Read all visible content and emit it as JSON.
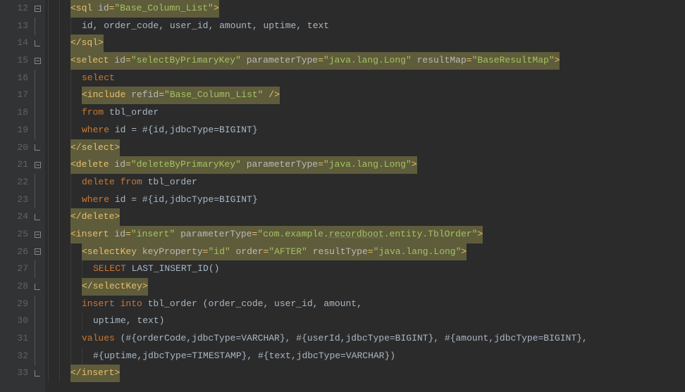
{
  "lines": [
    {
      "num": 12,
      "fold": "close",
      "tokens": [
        {
          "indent": 2
        },
        {
          "t": "<sql ",
          "c": "tag hl"
        },
        {
          "t": "id",
          "c": "attr-name hl"
        },
        {
          "t": "=",
          "c": "tag hl"
        },
        {
          "t": "\"Base_Column_List\"",
          "c": "attr-val hl"
        },
        {
          "t": ">",
          "c": "tag hl"
        }
      ]
    },
    {
      "num": 13,
      "fold": "line",
      "tokens": [
        {
          "indent": 3
        },
        {
          "t": "id",
          "c": "text"
        },
        {
          "t": ", ",
          "c": "text"
        },
        {
          "t": "order_code",
          "c": "text"
        },
        {
          "t": ", ",
          "c": "text"
        },
        {
          "t": "user_id",
          "c": "text"
        },
        {
          "t": ", ",
          "c": "text"
        },
        {
          "t": "amount",
          "c": "text"
        },
        {
          "t": ", ",
          "c": "text"
        },
        {
          "t": "uptime",
          "c": "text"
        },
        {
          "t": ", ",
          "c": "text"
        },
        {
          "t": "text",
          "c": "text"
        }
      ]
    },
    {
      "num": 14,
      "fold": "open",
      "tokens": [
        {
          "indent": 2
        },
        {
          "t": "</sql>",
          "c": "tag hl"
        }
      ]
    },
    {
      "num": 15,
      "fold": "close",
      "tokens": [
        {
          "indent": 2
        },
        {
          "t": "<select ",
          "c": "tag hl"
        },
        {
          "t": "id",
          "c": "attr-name hl"
        },
        {
          "t": "=",
          "c": "tag hl"
        },
        {
          "t": "\"selectByPrimaryKey\"",
          "c": "attr-val hl"
        },
        {
          "t": " ",
          "c": "hl"
        },
        {
          "t": "parameterType",
          "c": "attr-name hl"
        },
        {
          "t": "=",
          "c": "tag hl"
        },
        {
          "t": "\"java.lang.Long\"",
          "c": "attr-val hl"
        },
        {
          "t": " ",
          "c": "hl"
        },
        {
          "t": "resultMap",
          "c": "attr-name hl"
        },
        {
          "t": "=",
          "c": "tag hl"
        },
        {
          "t": "\"BaseResultMap\"",
          "c": "attr-val hl"
        },
        {
          "t": ">",
          "c": "tag hl"
        }
      ]
    },
    {
      "num": 16,
      "fold": "line",
      "tokens": [
        {
          "indent": 3
        },
        {
          "t": "select",
          "c": "keyword"
        }
      ]
    },
    {
      "num": 17,
      "fold": "line",
      "tokens": [
        {
          "indent": 3
        },
        {
          "t": "<include ",
          "c": "tag hl"
        },
        {
          "t": "refid",
          "c": "attr-name hl"
        },
        {
          "t": "=",
          "c": "tag hl"
        },
        {
          "t": "\"Base_Column_List\"",
          "c": "attr-val hl"
        },
        {
          "t": " />",
          "c": "tag hl"
        }
      ]
    },
    {
      "num": 18,
      "fold": "line",
      "tokens": [
        {
          "indent": 3
        },
        {
          "t": "from",
          "c": "keyword"
        },
        {
          "t": " tbl_order",
          "c": "text"
        }
      ]
    },
    {
      "num": 19,
      "fold": "line",
      "tokens": [
        {
          "indent": 3
        },
        {
          "t": "where",
          "c": "keyword"
        },
        {
          "t": " id = #{id,jdbcType=BIGINT}",
          "c": "text"
        }
      ]
    },
    {
      "num": 20,
      "fold": "open",
      "tokens": [
        {
          "indent": 2
        },
        {
          "t": "</select>",
          "c": "tag hl"
        }
      ]
    },
    {
      "num": 21,
      "fold": "close",
      "tokens": [
        {
          "indent": 2
        },
        {
          "t": "<delete ",
          "c": "tag hl"
        },
        {
          "t": "id",
          "c": "attr-name hl"
        },
        {
          "t": "=",
          "c": "tag hl"
        },
        {
          "t": "\"deleteByPrimaryKey\"",
          "c": "attr-val hl"
        },
        {
          "t": " ",
          "c": "hl"
        },
        {
          "t": "parameterType",
          "c": "attr-name hl"
        },
        {
          "t": "=",
          "c": "tag hl"
        },
        {
          "t": "\"java.lang.Long\"",
          "c": "attr-val hl"
        },
        {
          "t": ">",
          "c": "tag hl"
        }
      ]
    },
    {
      "num": 22,
      "fold": "line",
      "tokens": [
        {
          "indent": 3
        },
        {
          "t": "delete from",
          "c": "keyword"
        },
        {
          "t": " tbl_order",
          "c": "text"
        }
      ]
    },
    {
      "num": 23,
      "fold": "line",
      "tokens": [
        {
          "indent": 3
        },
        {
          "t": "where",
          "c": "keyword"
        },
        {
          "t": " id = #{id,jdbcType=BIGINT}",
          "c": "text"
        }
      ]
    },
    {
      "num": 24,
      "fold": "open",
      "tokens": [
        {
          "indent": 2
        },
        {
          "t": "</delete>",
          "c": "tag hl"
        }
      ]
    },
    {
      "num": 25,
      "fold": "close",
      "tokens": [
        {
          "indent": 2
        },
        {
          "t": "<insert ",
          "c": "tag hl"
        },
        {
          "t": "id",
          "c": "attr-name hl"
        },
        {
          "t": "=",
          "c": "tag hl"
        },
        {
          "t": "\"insert\"",
          "c": "attr-val hl"
        },
        {
          "t": " ",
          "c": "hl"
        },
        {
          "t": "parameterType",
          "c": "attr-name hl"
        },
        {
          "t": "=",
          "c": "tag hl"
        },
        {
          "t": "\"com.example.",
          "c": "attr-val hl"
        },
        {
          "t": "recordboot",
          "c": "attr-val hl underline"
        },
        {
          "t": ".entity.TblOrder\"",
          "c": "attr-val hl"
        },
        {
          "t": ">",
          "c": "tag hl"
        }
      ]
    },
    {
      "num": 26,
      "fold": "close",
      "tokens": [
        {
          "indent": 3
        },
        {
          "t": "<selectKey ",
          "c": "tag hl"
        },
        {
          "t": "keyProperty",
          "c": "attr-name hl"
        },
        {
          "t": "=",
          "c": "tag hl"
        },
        {
          "t": "\"id\"",
          "c": "attr-val hl"
        },
        {
          "t": " ",
          "c": "hl"
        },
        {
          "t": "order",
          "c": "attr-name hl"
        },
        {
          "t": "=",
          "c": "tag hl"
        },
        {
          "t": "\"AFTER\"",
          "c": "attr-val hl"
        },
        {
          "t": " ",
          "c": "hl"
        },
        {
          "t": "resultType",
          "c": "attr-name hl"
        },
        {
          "t": "=",
          "c": "tag hl"
        },
        {
          "t": "\"java.lang.Long\"",
          "c": "attr-val hl"
        },
        {
          "t": ">",
          "c": "tag hl"
        }
      ]
    },
    {
      "num": 27,
      "fold": "line",
      "tokens": [
        {
          "indent": 4
        },
        {
          "t": "SELECT",
          "c": "keyword"
        },
        {
          "t": " LAST_INSERT_ID()",
          "c": "text"
        }
      ]
    },
    {
      "num": 28,
      "fold": "open",
      "tokens": [
        {
          "indent": 3
        },
        {
          "t": "</selectKey>",
          "c": "tag hl"
        }
      ]
    },
    {
      "num": 29,
      "fold": "line",
      "tokens": [
        {
          "indent": 3
        },
        {
          "t": "insert into",
          "c": "keyword"
        },
        {
          "t": " tbl_order (order_code, user_id, amount,",
          "c": "text"
        }
      ]
    },
    {
      "num": 30,
      "fold": "line",
      "tokens": [
        {
          "indent": 4
        },
        {
          "t": "uptime, text)",
          "c": "text"
        }
      ]
    },
    {
      "num": 31,
      "fold": "line",
      "tokens": [
        {
          "indent": 3
        },
        {
          "t": "values",
          "c": "keyword"
        },
        {
          "t": " (#{orderCode,jdbcType=VARCHAR}, #{userId,jdbcType=BIGINT}, #{amount,jdbcType=BIGINT},",
          "c": "text"
        }
      ]
    },
    {
      "num": 32,
      "fold": "line",
      "tokens": [
        {
          "indent": 4
        },
        {
          "t": "#{uptime,jdbcType=TIMESTAMP}, #{text,jdbcType=VARCHAR})",
          "c": "text"
        }
      ]
    },
    {
      "num": 33,
      "fold": "open",
      "tokens": [
        {
          "indent": 2
        },
        {
          "t": "</insert>",
          "c": "tag hl"
        }
      ]
    }
  ]
}
